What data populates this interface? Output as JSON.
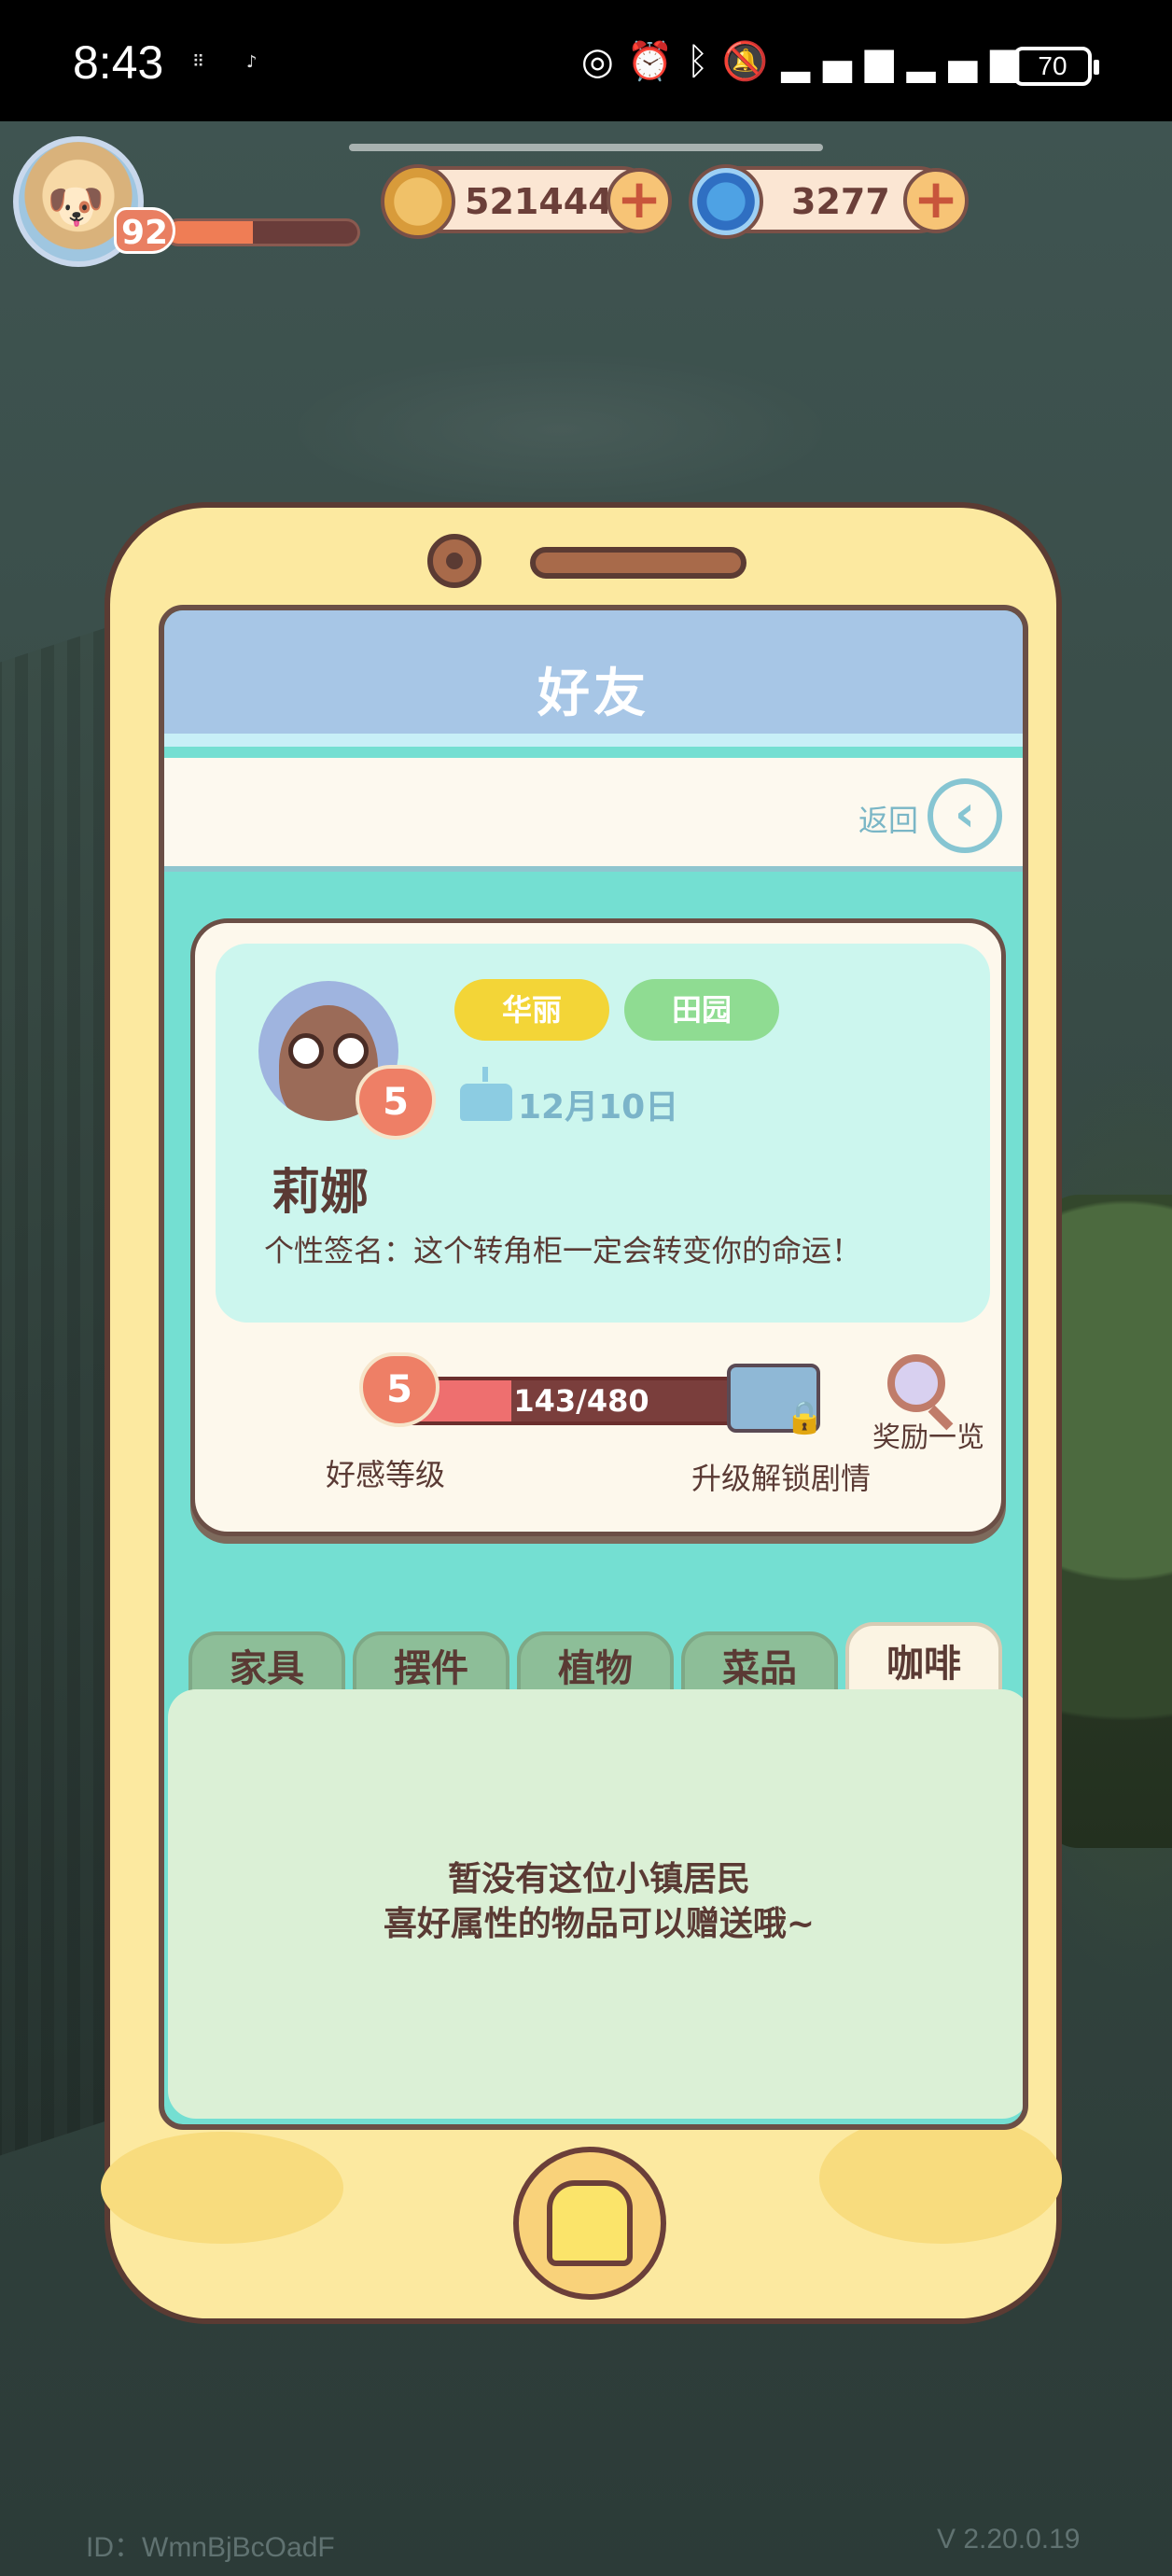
{
  "status_bar": {
    "time": "8:43",
    "notif_icons": [
      "notification-icon",
      "tiktok-icon"
    ],
    "system_icons": [
      "hotspot-icon",
      "alarm-icon",
      "bluetooth-icon",
      "mute-icon",
      "signal-icon",
      "signal-icon"
    ],
    "battery": "70"
  },
  "hud": {
    "player_level": "92",
    "exp_fraction": 0.45,
    "coins": "521444",
    "gems": "3277"
  },
  "screen": {
    "title": "好友",
    "back_label": "返回"
  },
  "profile": {
    "tags": [
      "华丽",
      "田园"
    ],
    "birthday": "12月10日",
    "name": "莉娜",
    "signature": "个性签名：这个转角柜一定会转变你的命运！",
    "heart_level": "5"
  },
  "affection": {
    "level": "5",
    "progress_text": "143/480",
    "progress_fraction": 0.298,
    "level_label": "好感等级",
    "unlock_label": "升级解锁剧情",
    "reward_label": "奖励一览"
  },
  "tabs": {
    "items": [
      "家具",
      "摆件",
      "植物",
      "菜品",
      "咖啡"
    ],
    "active_index": 4
  },
  "content": {
    "empty_line1": "暂没有这位小镇居民",
    "empty_line2": "喜好属性的物品可以赠送哦~"
  },
  "footer": {
    "id_text": "ID：WmnBjBcOadF",
    "version": "V 2.20.0.19"
  },
  "colors": {
    "phone_frame": "#fce9a0",
    "screen_bg": "#74dfd2",
    "title_band": "#a7c6e6",
    "accent_heart": "#ee7f66",
    "tag_gold": "#f3d537",
    "tag_green": "#8fdc92"
  }
}
